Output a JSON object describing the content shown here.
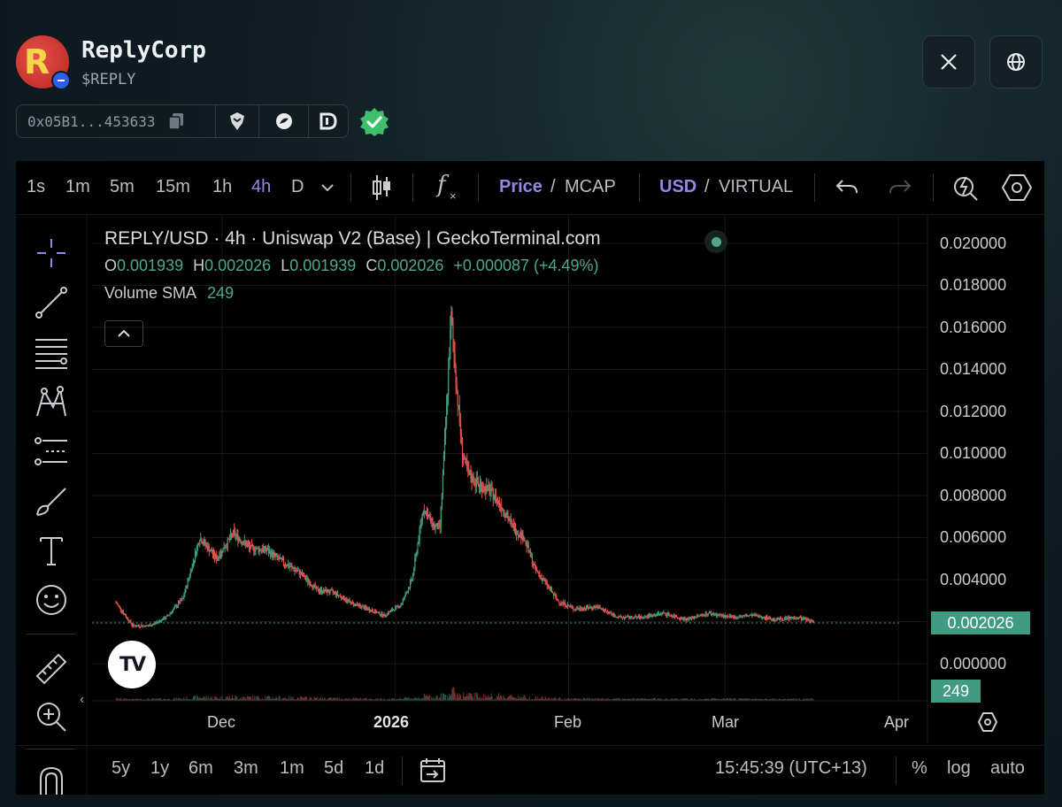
{
  "header": {
    "logo_letter": "R",
    "token_name": "ReplyCorp",
    "ticker": "$REPLY",
    "address": "0x05B1...453633",
    "x_button_icon": "x-logo-icon",
    "website_button_icon": "globe-icon"
  },
  "toolbar": {
    "intervals": [
      "1s",
      "1m",
      "5m",
      "15m",
      "1h",
      "4h",
      "D"
    ],
    "active_interval": "4h",
    "price_label": "Price",
    "mcap_label": "MCAP",
    "usd_label": "USD",
    "virtual_label": "VIRTUAL",
    "slash": "/"
  },
  "legend": {
    "title": "REPLY/USD · 4h · Uniswap V2 (Base) | GeckoTerminal.com",
    "o_label": "O",
    "o_value": "0.001939",
    "h_label": "H",
    "h_value": "0.002026",
    "l_label": "L",
    "l_value": "0.001939",
    "c_label": "C",
    "c_value": "0.002026",
    "change": "+0.000087 (+4.49%)",
    "volume_label": "Volume SMA",
    "volume_value": "249"
  },
  "price_scale": {
    "ticks": [
      "0.020000",
      "0.018000",
      "0.016000",
      "0.014000",
      "0.012000",
      "0.010000",
      "0.008000",
      "0.006000",
      "0.004000",
      "0.000000"
    ],
    "current_price": "0.002026",
    "volume_tag": "249"
  },
  "time_scale": {
    "ticks": [
      "Dec",
      "2026",
      "Feb",
      "Mar",
      "Apr"
    ]
  },
  "bottom_bar": {
    "ranges": [
      "5y",
      "1y",
      "6m",
      "3m",
      "1m",
      "5d",
      "1d"
    ],
    "clock": "15:45:39 (UTC+13)",
    "percent_label": "%",
    "log_label": "log",
    "auto_label": "auto"
  },
  "colors": {
    "up": "#3f9c82",
    "down": "#e0524d",
    "accent": "#8f89ea",
    "background": "#000000"
  },
  "chart_data": {
    "type": "candlestick",
    "title": "REPLY/USD · 4h · Uniswap V2 (Base) | GeckoTerminal.com",
    "ylim": [
      0,
      0.02
    ],
    "x": [
      "2025-11-12",
      "2025-11-15",
      "2025-11-18",
      "2025-11-21",
      "2025-11-24",
      "2025-11-27",
      "2025-11-30",
      "2025-12-03",
      "2025-12-06",
      "2025-12-09",
      "2025-12-12",
      "2025-12-15",
      "2025-12-18",
      "2025-12-21",
      "2025-12-24",
      "2025-12-27",
      "2025-12-30",
      "2026-01-02",
      "2026-01-04",
      "2026-01-06",
      "2026-01-08",
      "2026-01-09",
      "2026-01-10",
      "2026-01-11",
      "2026-01-12",
      "2026-01-13",
      "2026-01-14",
      "2026-01-16",
      "2026-01-18",
      "2026-01-20",
      "2026-01-22",
      "2026-01-24",
      "2026-01-26",
      "2026-01-28",
      "2026-01-30",
      "2026-02-02",
      "2026-02-06",
      "2026-02-10",
      "2026-02-14",
      "2026-02-18",
      "2026-02-22",
      "2026-02-26",
      "2026-03-02",
      "2026-03-06",
      "2026-03-10",
      "2026-03-14",
      "2026-03-17"
    ],
    "series": [
      {
        "close": [
          0.0029,
          0.0018,
          0.0018,
          0.0022,
          0.0031,
          0.006,
          0.005,
          0.0062,
          0.0055,
          0.0054,
          0.0048,
          0.0043,
          0.0035,
          0.0034,
          0.0029,
          0.0026,
          0.0023,
          0.0028,
          0.004,
          0.0074,
          0.0065,
          0.0065,
          0.0113,
          0.0165,
          0.013,
          0.01,
          0.009,
          0.0085,
          0.0082,
          0.0075,
          0.0065,
          0.006,
          0.0045,
          0.0038,
          0.003,
          0.0026,
          0.0027,
          0.0022,
          0.0022,
          0.0024,
          0.0021,
          0.0024,
          0.0022,
          0.0023,
          0.0021,
          0.0022,
          0.002
        ]
      }
    ],
    "volume_sma": 249,
    "last_price": 0.002026
  }
}
